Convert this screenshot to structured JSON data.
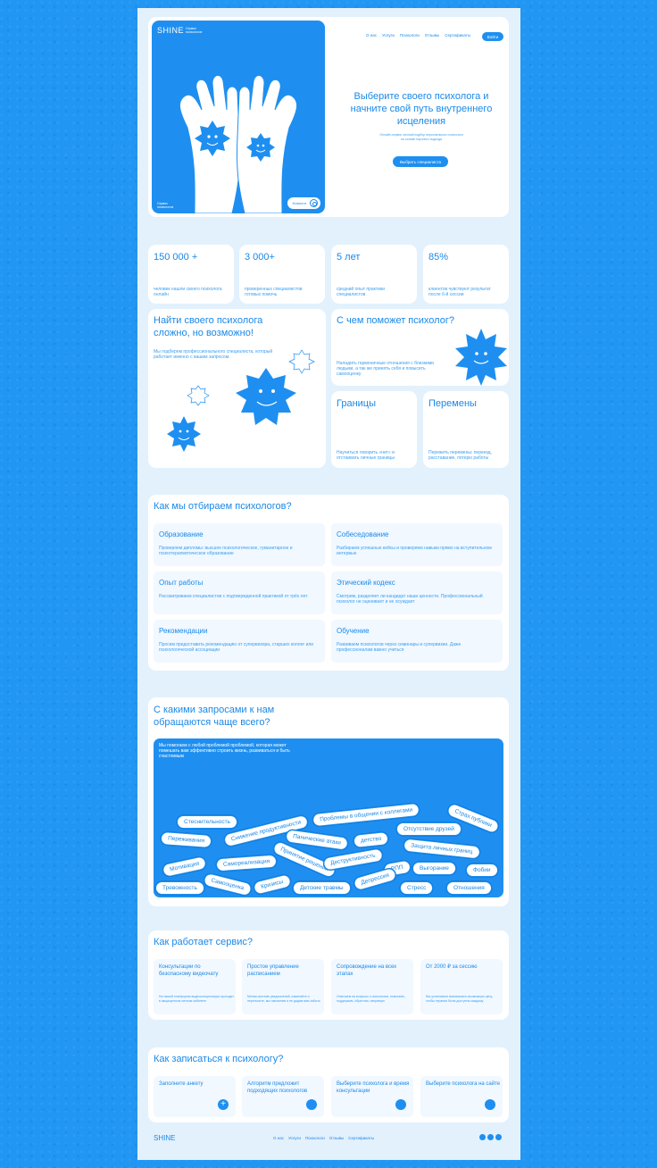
{
  "brand": {
    "name": "SHINE",
    "tagline": "Сервис психологов"
  },
  "nav": [
    "О нас",
    "Услуги",
    "Психологи",
    "Отзывы",
    "Сертификаты"
  ],
  "login_label": "Войти",
  "hero": {
    "title": "Выберите своего психолога и начните свой путь внутреннего исцеления",
    "subtitle": "Онлайн-сервис личный подбор персонального психолога на основе научного подхода",
    "cta": "Выбрать специалиста",
    "corner_label": "Сервис психологов",
    "news_label": "Новости"
  },
  "stats": [
    {
      "num": "150 000 +",
      "desc": "человек нашли своего психолога онлайн"
    },
    {
      "num": "3 000+",
      "desc": "проверенных специалистов готовых помочь"
    },
    {
      "num": "5 лет",
      "desc": "средний опыт практики специалистов"
    },
    {
      "num": "85%",
      "desc": "клиентов чувствуют результат после 6-й сессии"
    }
  ],
  "find": {
    "title": "Найти своего психолога сложно, но возможно!",
    "desc": "Мы подберем профессионального специалиста, который работает именно с вашим запросом."
  },
  "help": {
    "title": "С чем поможет психолог?",
    "desc": "Наладить гармоничные отношения с близкими людьми, а так же принять себя и повысить самооценку"
  },
  "tiles": [
    {
      "title": "Границы",
      "desc": "Научиться говорить «нет» и отстаивать личные границы"
    },
    {
      "title": "Перемены",
      "desc": "Пережить перемены: переезд, расставание, потерю работы"
    }
  ],
  "selection": {
    "title": "Как мы отбираем психологов?",
    "items": [
      {
        "t": "Образование",
        "d": "Проверяем дипломы: высшее психологическое, гуманитарное и психотерапевтическое образование"
      },
      {
        "t": "Собеседование",
        "d": "Разбираем успешные кейсы и проверяем навыки прямо на вступительном интервью"
      },
      {
        "t": "Опыт работы",
        "d": "Рассматриваем специалистов с подтвержденной практикой от трёх лет"
      },
      {
        "t": "Этический кодекс",
        "d": "Смотрим, разделяет ли кандидат наши ценности. Профессиональный психолог не оценивает и не осуждает"
      },
      {
        "t": "Рекомендации",
        "d": "Просим предоставить рекомендацию от супервизора, старших коллег или психологической ассоциации"
      },
      {
        "t": "Обучение",
        "d": "Развиваем психологов через семинары и супервизии. Даже профессионалам важно учиться"
      }
    ]
  },
  "requests": {
    "title": "С какими запросами к нам обращаются чаще всего?",
    "intro": "Мы помогаем с любой проблемой проблемой, которая может помешать вам эффективно строить жизнь, развиваться и быть счастливым",
    "pills": [
      "Стеснительность",
      "Переживания",
      "Снижение продуктивности",
      "Проблемы в общении с коллегами",
      "Страх публики",
      "Панические атаки",
      "детство",
      "Отсутствие друзей",
      "Мотивация",
      "Самореализация",
      "Принятие решений",
      "Деструктивность",
      "Защита личных границ",
      "РПП",
      "Выгорание",
      "Фобии",
      "Тревожность",
      "Самооценка",
      "Кризисы",
      "Детские травмы",
      "Депрессия",
      "Стресс",
      "Отношения"
    ]
  },
  "how": {
    "title": "Как работает сервис?",
    "items": [
      {
        "t": "Консультации по безопасному видеочату",
        "d": "На нашей платформе видеоконсультации проходят в защищенном личном кабинете"
      },
      {
        "t": "Простое управление расписанием",
        "d": "Меняя системе уведомлений, изменяйте и переносите, мы напомним и не дадим вам забыть"
      },
      {
        "t": "Сопровождение на всех этапах",
        "d": "Отвечаем на вопросы о психологии, помогаем, поддержим, обратная, напрямую"
      },
      {
        "t": "От 2000 ₽ за сессию",
        "d": "Мы установили минимально возможную цену, чтобы терапия была доступна каждому"
      }
    ]
  },
  "signup": {
    "title": "Как записаться к психологу?",
    "steps": [
      "Заполните анкету",
      "Алгоритм предложит подходящих психологов",
      "Выберите психолога и время консультации",
      "Выберите психолога на сайте"
    ],
    "plus": "+"
  },
  "footer": {
    "logo": "SHINE",
    "nav": [
      "О нас",
      "Услуги",
      "Психологи",
      "Отзывы",
      "Сертификаты"
    ]
  }
}
